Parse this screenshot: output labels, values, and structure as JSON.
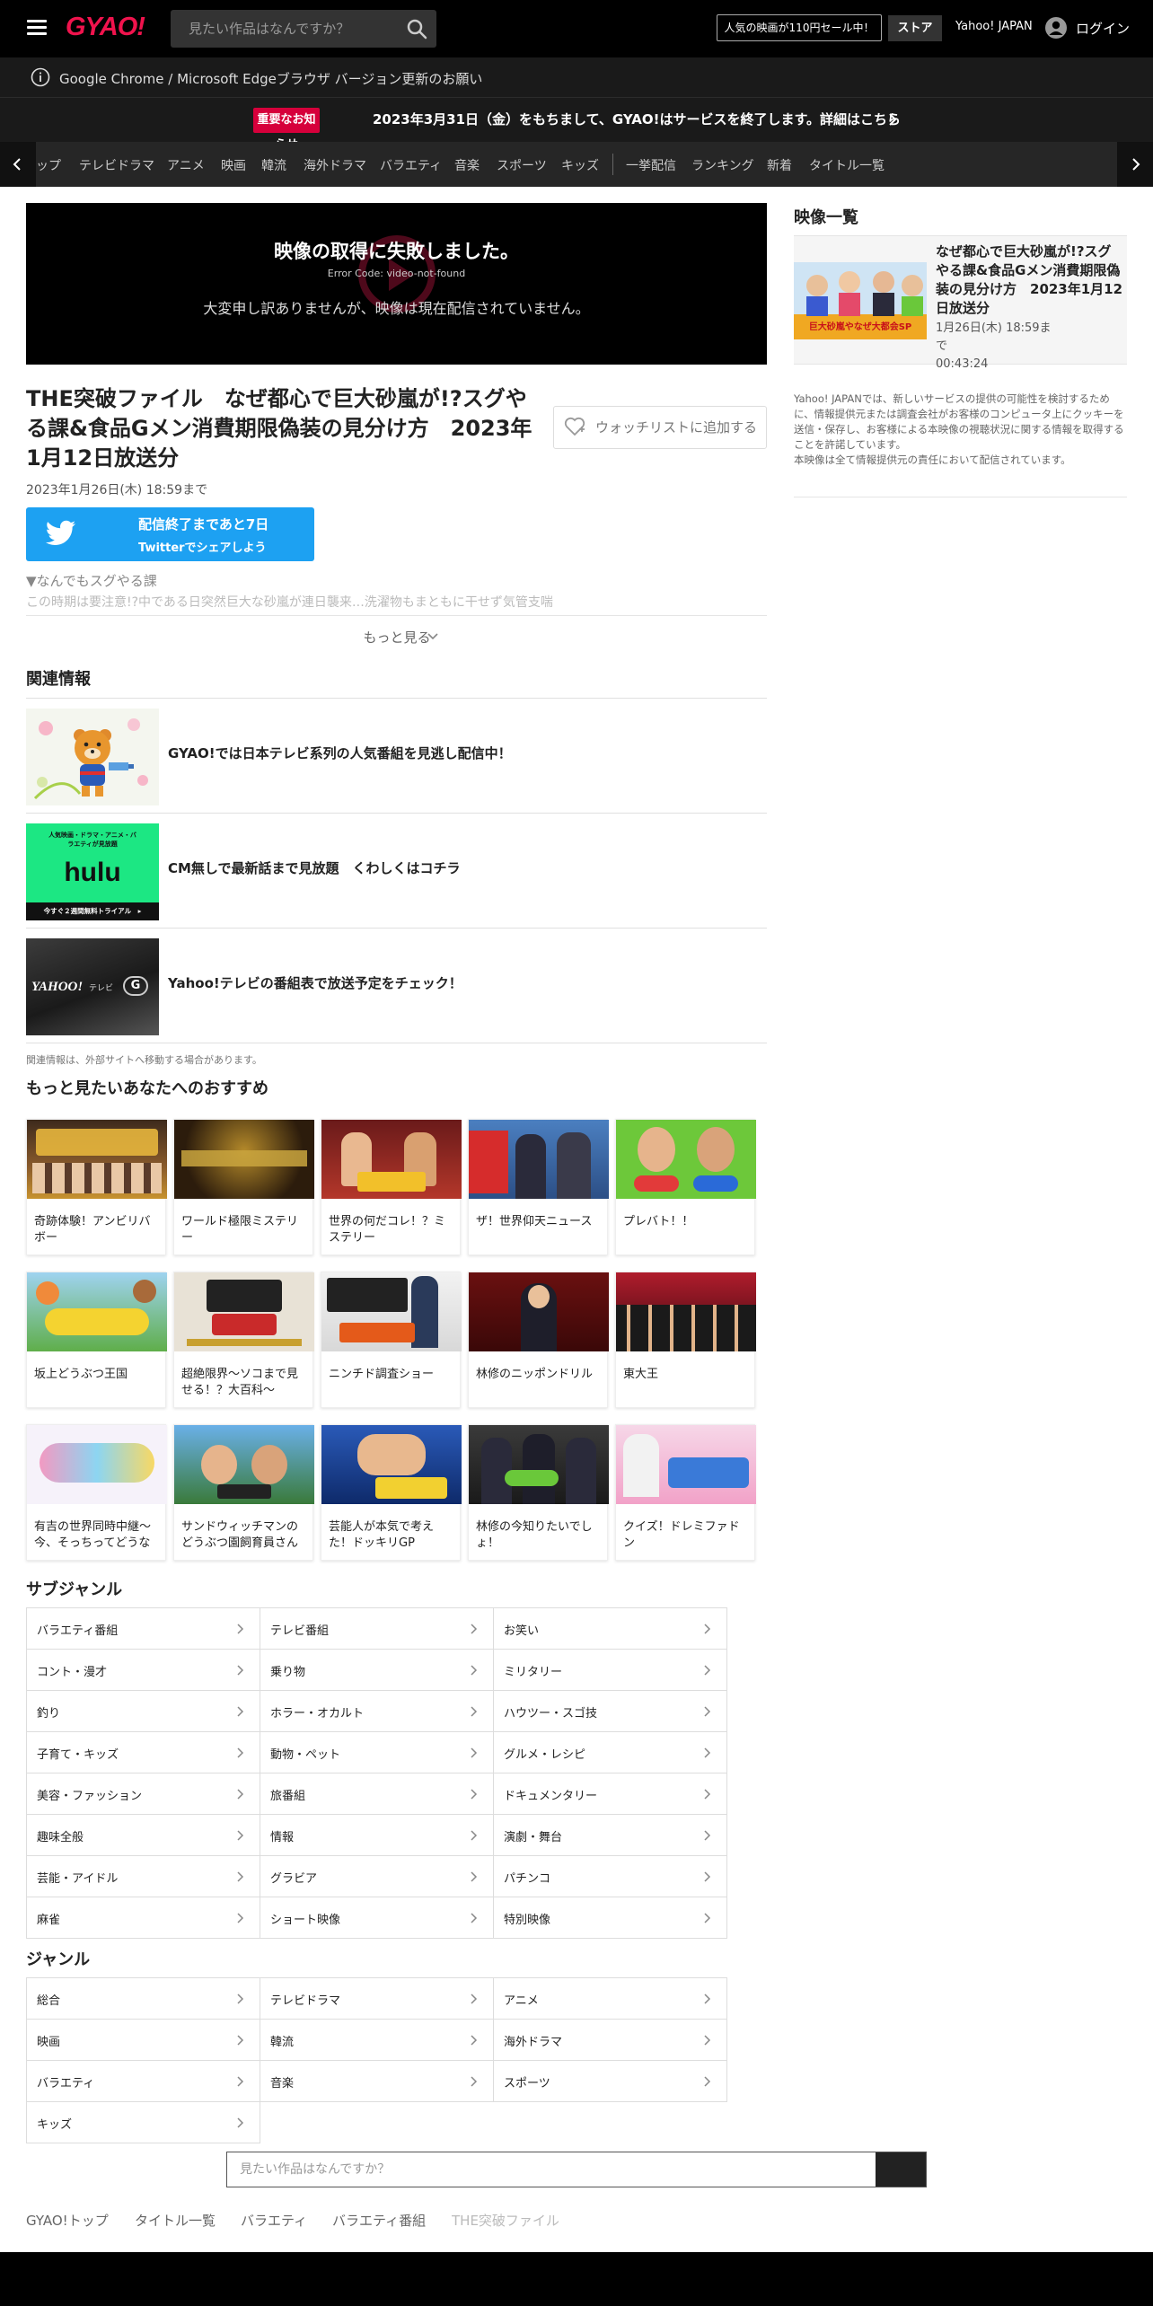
{
  "header": {
    "logo": "GYAO!",
    "search_placeholder": "見たい作品はなんですか？",
    "promo": "人気の映画が110円セール中！",
    "store": "ストア",
    "yahoo": "Yahoo! JAPAN",
    "login": "ログイン"
  },
  "browser_notice": "Google Chrome / Microsoft Edgeブラウザ バージョン更新のお願い",
  "notice": {
    "badge": "重要なお知らせ",
    "text": "2023年3月31日（金）をもちまして、GYAO!はサービスを終了します。詳細はこちら"
  },
  "nav": {
    "items": [
      "トップ",
      "テレビドラマ",
      "アニメ",
      "映画",
      "韓流",
      "海外ドラマ",
      "バラエティ",
      "音楽",
      "スポーツ",
      "キッズ",
      "一挙配信",
      "ランキング",
      "新着",
      "タイトル一覧"
    ]
  },
  "player": {
    "error": "映像の取得に失敗しました。",
    "code": "Error Code: video-not-found",
    "message": "大変申し訳ありませんが、映像は現在配信されていません。"
  },
  "video": {
    "title": "THE突破ファイル　なぜ都心で巨大砂嵐が!?スグやる課&食品Gメン消費期限偽装の見分け方　2023年1月12日放送分",
    "watchlist": "ウォッチリストに追加する",
    "deadline": "2023年1月26日(木) 18:59まで",
    "twitter_line1": "配信終了まであと7日",
    "twitter_line2": "Twitterでシェアしよう",
    "desc_heading": "▼なんでもスグやる課",
    "desc_text": "この時期は要注意!?中である日突然巨大な砂嵐が連日襲来…洗濯物もまともに干せず気管支喘",
    "more": "もっと見る"
  },
  "related": {
    "heading": "関連情報",
    "items": [
      {
        "text": "GYAO!では日本テレビ系列の人気番組を見逃し配信中！"
      },
      {
        "text": "CM無しで最新話まで見放題　くわしくはコチラ",
        "banner_top": "人気映画・ドラマ・アニメ・バラエティが見放題",
        "banner_logo": "hulu",
        "banner_bottom": "今すぐ２週間無料トライアル　▸"
      },
      {
        "text": "Yahoo!テレビの番組表で放送予定をチェック！",
        "banner_logo": "YAHOO!",
        "banner_small": "テレビ",
        "banner_g": "G"
      }
    ],
    "note": "関連情報は、外部サイトへ移動する場合があります。"
  },
  "recommend": {
    "heading": "もっと見たいあなたへのおすすめ",
    "cards": [
      {
        "title": "奇跡体験！アンビリバボー"
      },
      {
        "title": "ワールド極限ミステリー"
      },
      {
        "title": "世界の何だコレ！？ミステリー"
      },
      {
        "title": "ザ！世界仰天ニュース"
      },
      {
        "title": "プレバト！！"
      },
      {
        "title": "坂上どうぶつ王国"
      },
      {
        "title": "超絶限界～ソコまで見せる！？大百科～"
      },
      {
        "title": "ニンチド調査ショー"
      },
      {
        "title": "林修のニッポンドリル"
      },
      {
        "title": "東大王"
      },
      {
        "title": "有吉の世界同時中継～今、そっちってどうな"
      },
      {
        "title": "サンドウィッチマンのどうぶつ園飼育員さん"
      },
      {
        "title": "芸能人が本気で考えた！ドッキリGP"
      },
      {
        "title": "林修の今知りたいでしょ！"
      },
      {
        "title": "クイズ！ドレミファドン"
      }
    ]
  },
  "subgenre": {
    "heading": "サブジャンル",
    "items": [
      "バラエティ番組",
      "テレビ番組",
      "お笑い",
      "コント・漫才",
      "乗り物",
      "ミリタリー",
      "釣り",
      "ホラー・オカルト",
      "ハウツー・スゴ技",
      "子育て・キッズ",
      "動物・ペット",
      "グルメ・レシピ",
      "美容・ファッション",
      "旅番組",
      "ドキュメンタリー",
      "趣味全般",
      "情報",
      "演劇・舞台",
      "芸能・アイドル",
      "グラビア",
      "パチンコ",
      "麻雀",
      "ショート映像",
      "特別映像"
    ]
  },
  "genre": {
    "heading": "ジャンル",
    "items": [
      "総合",
      "テレビドラマ",
      "アニメ",
      "映画",
      "韓流",
      "海外ドラマ",
      "バラエティ",
      "音楽",
      "スポーツ",
      "キッズ"
    ]
  },
  "bottom_search_placeholder": "見たい作品はなんですか？",
  "breadcrumb": [
    "GYAO!トップ",
    "タイトル一覧",
    "バラエティ",
    "バラエティ番組",
    "THE突破ファイル"
  ],
  "sidebar": {
    "heading": "映像一覧",
    "item_title": "なぜ都心で巨大砂嵐が!?スグやる課&食品Gメン消費期限偽装の見分け方　2023年1月12日放送分",
    "item_date": "1月26日(木) 18:59まで",
    "item_duration": "00:43:24",
    "thumb_caption": "巨大砂嵐やなぜ大都会SP",
    "note": "Yahoo! JAPANでは、新しいサービスの提供の可能性を検討するために、情報提供元または調査会社がお客様のコンピュータ上にクッキーを送信・保存し、お客様による本映像の視聴状況に関する情報を取得することを許諾しています。\n本映像は全て情報提供元の責任において配信されています。"
  },
  "colors": {
    "brand": "#f0134d",
    "twitter": "#1da1f2",
    "notice_badge": "#d6003b"
  }
}
